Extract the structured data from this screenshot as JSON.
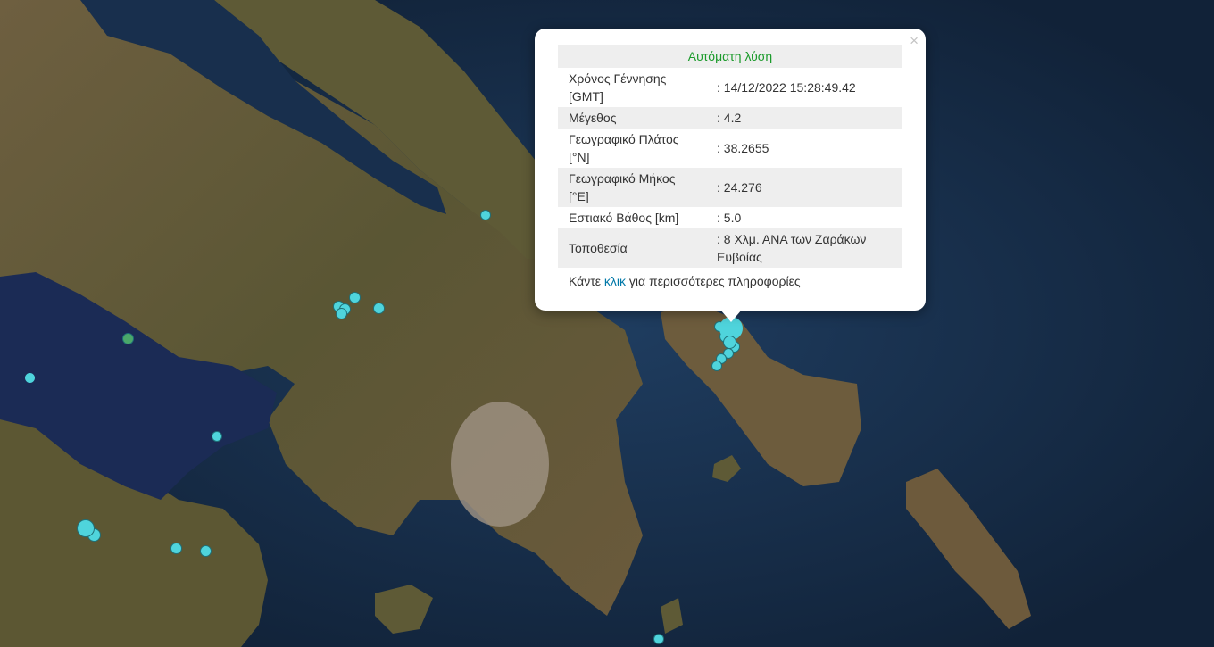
{
  "map": {
    "colors": {
      "sea_deep": "#13273f",
      "sea": "#1b3656",
      "gulf": "#1a2d55",
      "land": "#6a5a3a",
      "land_green": "#4b5a32",
      "urban": "#a5998a",
      "marker_fill": "#4fd4dc",
      "marker_green": "#4aa86a"
    }
  },
  "popup": {
    "title": "Αυτόματη λύση",
    "rows": [
      {
        "label": "Χρόνος Γέννησης [GMT]",
        "value": ": 14/12/2022 15:28:49.42"
      },
      {
        "label": "Μέγεθος",
        "value": ": 4.2"
      },
      {
        "label": "Γεωγραφικό Πλάτος [°N]",
        "value": ": 38.2655"
      },
      {
        "label": "Γεωγραφικό Μήκος [°E]",
        "value": ": 24.276"
      },
      {
        "label": "Εστιακό Βάθος [km]",
        "value": ": 5.0"
      },
      {
        "label": "Τοποθεσία",
        "value": ": 8 Χλμ. ΑΝΑ των Ζαράκων Ευβοίας"
      }
    ],
    "more_prefix": "Κάντε ",
    "more_link": "κλικ",
    "more_suffix": " για περισσότερες πληροφορίες",
    "close_glyph": "×"
  }
}
